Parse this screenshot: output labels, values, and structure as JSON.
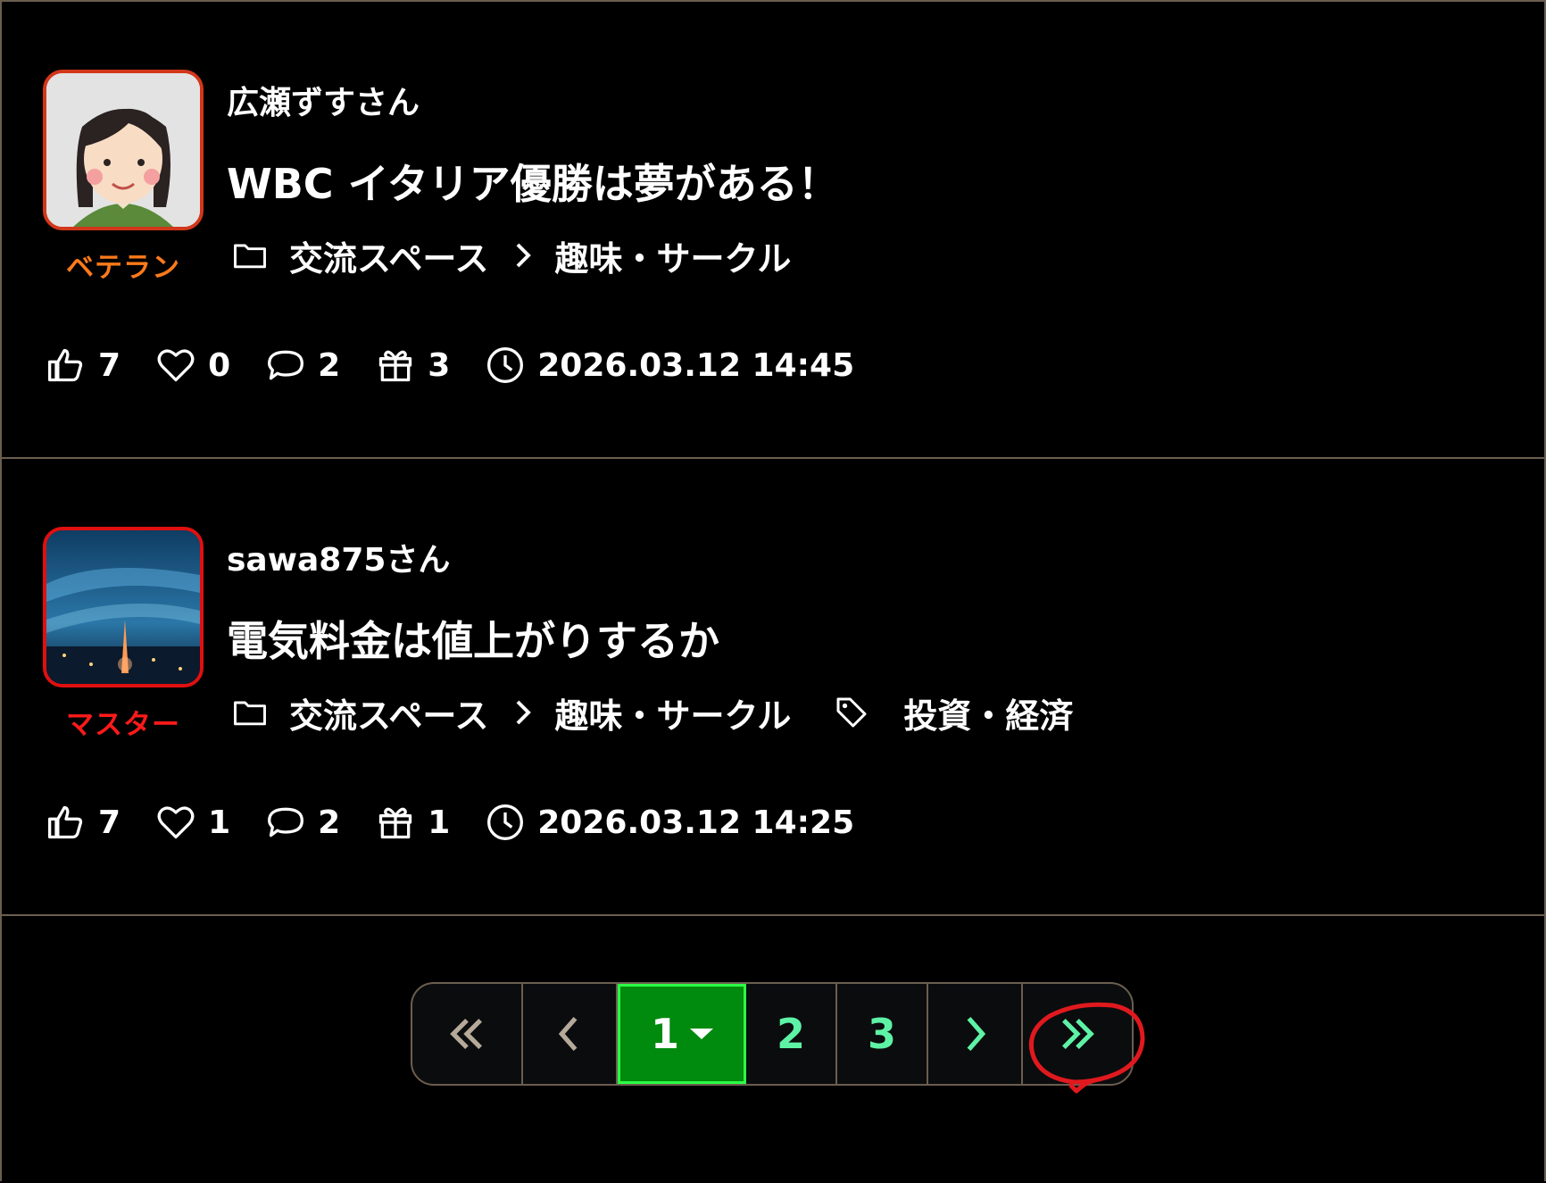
{
  "posts": [
    {
      "username": "広瀬ずすさん",
      "rank": "ベテラン",
      "rank_color": "#ff7a1a",
      "avatar": "woman-avatar-icon",
      "title": "WBC イタリア優勝は夢がある！",
      "category": "交流スペース",
      "subcategory": "趣味・サークル",
      "tag": "",
      "likes": "7",
      "hearts": "0",
      "comments": "2",
      "gifts": "3",
      "datetime": "2026.03.12 14:45"
    },
    {
      "username": "sawa875さん",
      "rank": "マスター",
      "rank_color": "#ff1a1a",
      "avatar": "night-city-tower-image",
      "title": "電気料金は値上がりするか",
      "category": "交流スペース",
      "subcategory": "趣味・サークル",
      "tag": "投資・経済",
      "likes": "7",
      "hearts": "1",
      "comments": "2",
      "gifts": "1",
      "datetime": "2026.03.12 14:25"
    }
  ],
  "pagination": {
    "current": "1",
    "pages": [
      "2",
      "3"
    ],
    "accent": "#5ef2a6",
    "current_bg": "#008a0e"
  },
  "colors": {
    "divider": "#6b5e4f",
    "annotation": "#e0191e"
  }
}
